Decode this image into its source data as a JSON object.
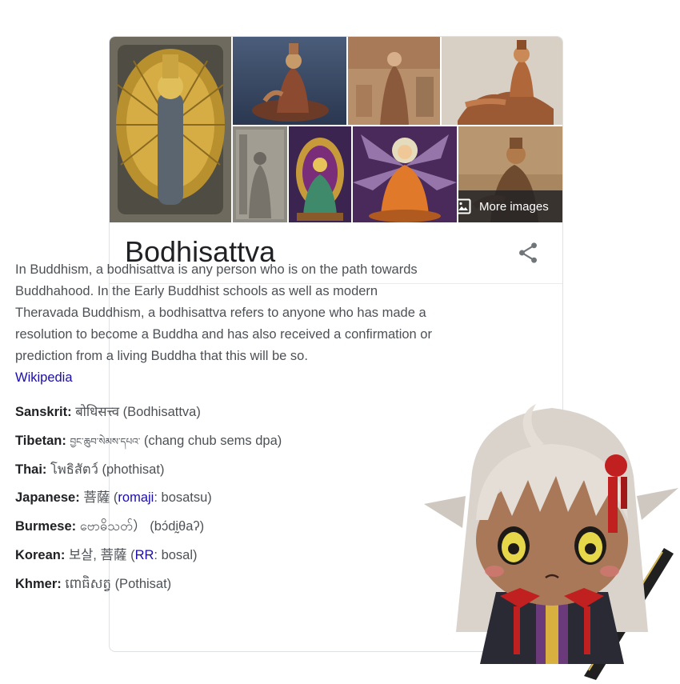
{
  "panel": {
    "title": "Bodhisattva",
    "more_images_label": "More images",
    "description": "In Buddhism, a bodhisattva is any person who is on the path towards Buddhahood. In the Early Buddhist schools as well as modern Theravada Buddhism, a bodhisattva refers to anyone who has made a resolution to become a Buddha and has also received a confirmation or prediction from a living Buddha that this will be so.",
    "source_link": "Wikipedia",
    "facts": [
      {
        "label": "Sanskrit:",
        "native": "बोधिसत्त्व",
        "pre_link": "(Bodhisattva)",
        "link": "",
        "post_link": ""
      },
      {
        "label": "Tibetan:",
        "native": "བྱང་ཆུབ་སེམས་དཔའ་",
        "pre_link": "(chang chub sems dpa)",
        "link": "",
        "post_link": ""
      },
      {
        "label": "Thai:",
        "native": "โพธิสัตว์",
        "pre_link": "(phothisat)",
        "link": "",
        "post_link": ""
      },
      {
        "label": "Japanese:",
        "native": "菩薩",
        "pre_link": "(",
        "link": "romaji",
        "post_link": ": bosatsu)"
      },
      {
        "label": "Burmese:",
        "native": "ဗောဓိသတ်）",
        "pre_link": "(bɔ́dḭθaʔ)",
        "link": "",
        "post_link": ""
      },
      {
        "label": "Korean:",
        "native": "보살, 菩薩",
        "pre_link": "(",
        "link": "RR",
        "post_link": ": bosal)"
      },
      {
        "label": "Khmer:",
        "native": "ពោធិសត្វ",
        "pre_link": "(Pothisat)",
        "link": "",
        "post_link": ""
      }
    ]
  },
  "icons": {
    "share": "share-icon",
    "image": "image-icon"
  },
  "colors": {
    "link": "#1a0dab",
    "text": "#4d5156",
    "title": "#202124",
    "border": "#dfe1e5"
  }
}
